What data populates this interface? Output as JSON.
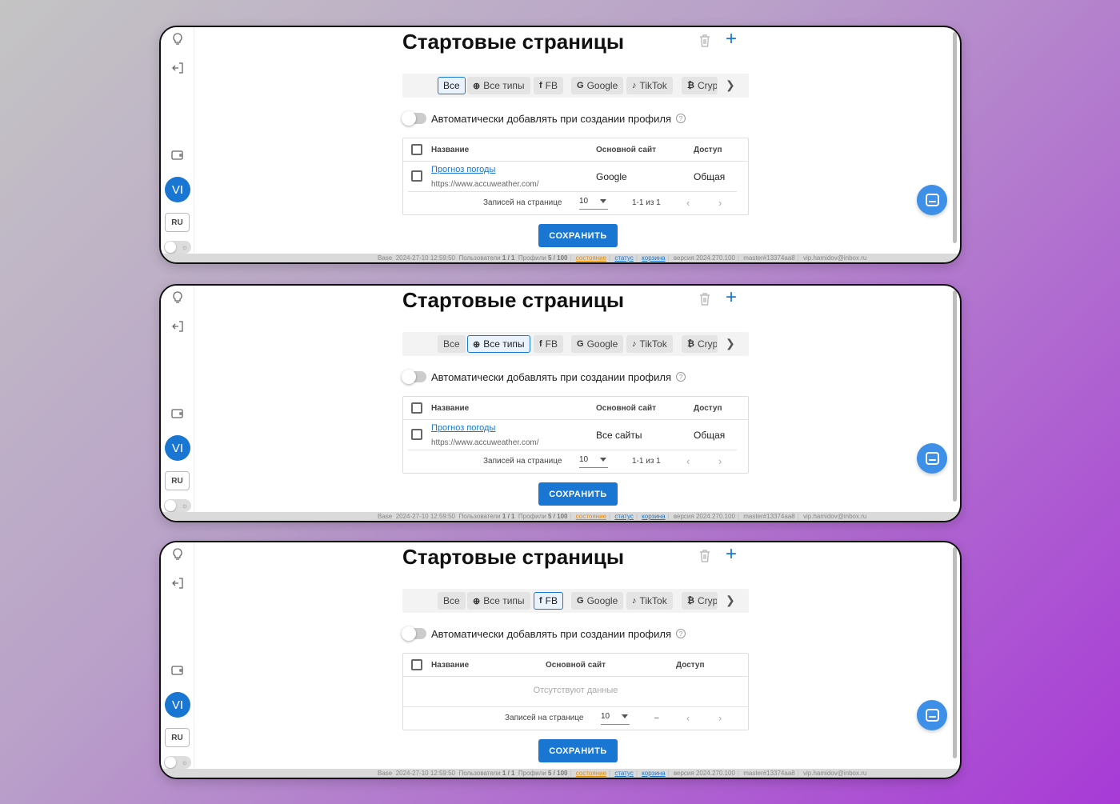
{
  "sidebar": {
    "avatar_initials": "VI",
    "lang": "RU",
    "icons": [
      "bulb-icon",
      "logout-icon",
      "wallet-icon"
    ]
  },
  "page": {
    "title": "Стартовые страницы"
  },
  "tabs": {
    "all": "Все",
    "all_types": "Все типы",
    "fb": "FB",
    "google": "Google",
    "tiktok": "TikTok",
    "crypto": "Cryp",
    "icon_fb": "f",
    "icon_google": "G",
    "icon_tiktok": "♪",
    "icon_crypto": "₿",
    "icon_all_types": "⊕"
  },
  "toggle": {
    "label": "Автоматически добавлять при создании профиля"
  },
  "table": {
    "col_name": "Название",
    "col_site": "Основной сайт",
    "col_access": "Доступ",
    "row": {
      "name": "Прогноз погоды",
      "url": "https://www.accuweather.com/",
      "access": "Общая"
    },
    "empty": "Отсутствуют данные",
    "per_page_label": "Записей на странице",
    "per_page": "10",
    "range": "1-1 из 1",
    "range_empty": "–"
  },
  "screens": [
    {
      "active_tab": "Все",
      "row_site": "Google"
    },
    {
      "active_tab": "Все типы",
      "row_site": "Все сайты"
    },
    {
      "active_tab": "FB"
    }
  ],
  "save_label": "СОХРАНИТЬ",
  "status_bar": {
    "base": "Base",
    "datetime": "2024-27-10 12:59:50",
    "users_label": "Пользователи",
    "users": "1 / 1",
    "profiles_label": "Профили",
    "profiles": "5 / 100",
    "state": "состояние",
    "status": "статус",
    "cart": "корзина",
    "version": "версия 2024.270.100",
    "build": "master#13374aa8",
    "email": "vip.hamidov@inbox.ru"
  },
  "colors": {
    "accent": "#1976d2",
    "background_start": "#c4c4c4",
    "background_end": "#a83ad6"
  }
}
